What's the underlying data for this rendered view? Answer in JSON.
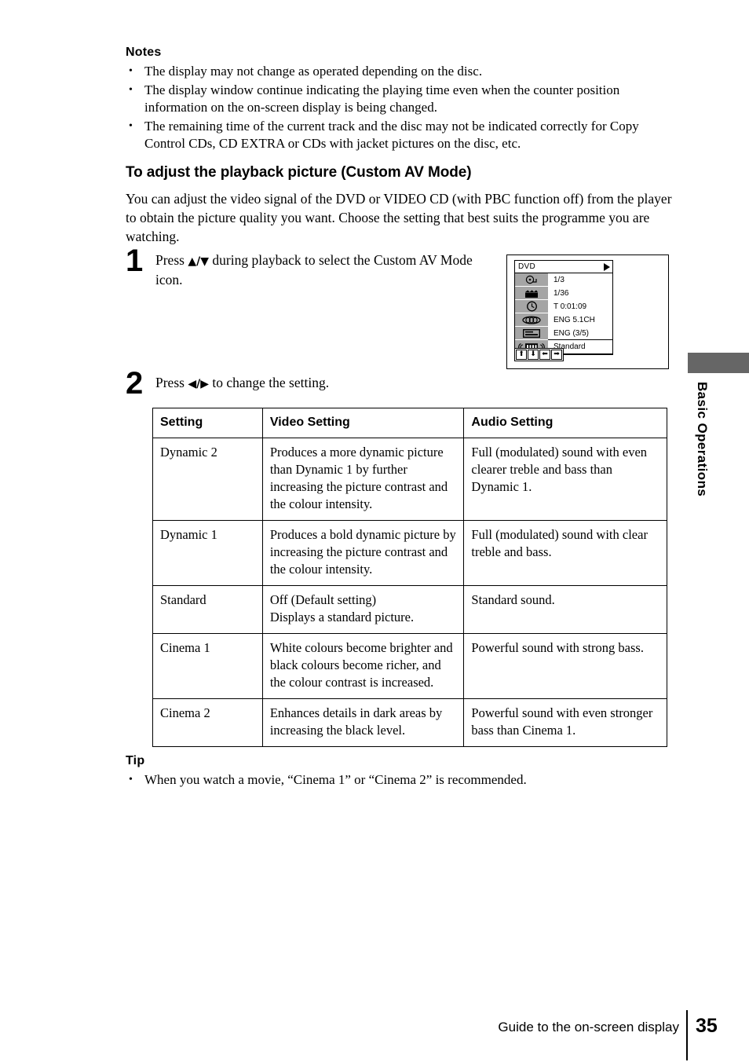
{
  "notes": {
    "heading": "Notes",
    "items": [
      "The display may not change as operated depending on the disc.",
      "The display window continue indicating the playing time even when the counter position information on the on-screen display is being changed.",
      "The remaining time of the current track and the disc may not be indicated correctly for Copy Control CDs, CD EXTRA or CDs with jacket pictures on the disc, etc."
    ]
  },
  "section": {
    "heading": "To adjust the playback picture (Custom AV Mode)",
    "intro": "You can adjust the video signal of the DVD or VIDEO CD (with PBC function off) from the player to obtain the picture quality you want.  Choose the setting that best suits the programme you are watching."
  },
  "steps": [
    {
      "number": "1",
      "text_before": "Press ",
      "keys": "♦/♦",
      "text_after": " during playback to select the Custom AV Mode icon."
    },
    {
      "number": "2",
      "text_before": "Press ",
      "keys": "♦/♦",
      "text_after": " to change the setting."
    }
  ],
  "osd": {
    "title": "DVD",
    "play_icon": "play-triangle-icon",
    "rows": [
      {
        "icon": "title-disc-icon",
        "value": "1/3",
        "selected": false
      },
      {
        "icon": "clapperboard-icon",
        "value": "1/36",
        "selected": false
      },
      {
        "icon": "clock-icon",
        "value": "T 0:01:09",
        "selected": false
      },
      {
        "icon": "audio-track-icon",
        "value": "ENG 5.1CH",
        "selected": false
      },
      {
        "icon": "subtitle-icon",
        "value": "ENG (3/5)",
        "selected": false
      },
      {
        "icon": "custom-av-mode-icon",
        "value": "Standard",
        "selected": true
      }
    ],
    "arrow_buttons": [
      "⬆",
      "⬇",
      "⬅",
      "➡"
    ],
    "icon_cell_color": "#a5a5a5"
  },
  "table": {
    "headers": [
      "Setting",
      "Video Setting",
      "Audio Setting"
    ],
    "rows": [
      {
        "setting": "Dynamic 2",
        "video": "Produces a more dynamic picture than Dynamic 1 by further increasing the picture contrast and the colour intensity.",
        "audio": "Full (modulated) sound with even clearer treble and bass than Dynamic 1."
      },
      {
        "setting": "Dynamic 1",
        "video": "Produces a bold dynamic picture by increasing the picture contrast and the colour intensity.",
        "audio": "Full (modulated) sound with clear treble and bass."
      },
      {
        "setting": "Standard",
        "video": "Off (Default setting)\nDisplays a standard picture.",
        "audio": "Standard sound."
      },
      {
        "setting": "Cinema 1",
        "video": "White colours become brighter and black colours become richer, and the colour contrast is increased.",
        "audio": "Powerful sound with strong bass."
      },
      {
        "setting": "Cinema 2",
        "video": "Enhances details in dark areas by increasing the black level.",
        "audio": "Powerful sound with even stronger bass than Cinema 1."
      }
    ]
  },
  "tip": {
    "heading": "Tip",
    "items": [
      "When you watch a movie, “Cinema 1” or “Cinema 2” is recommended."
    ]
  },
  "side_tab": {
    "label": "Basic Operations",
    "color": "#666666"
  },
  "footer": {
    "caption": "Guide to the on-screen display",
    "page_number": "35"
  }
}
